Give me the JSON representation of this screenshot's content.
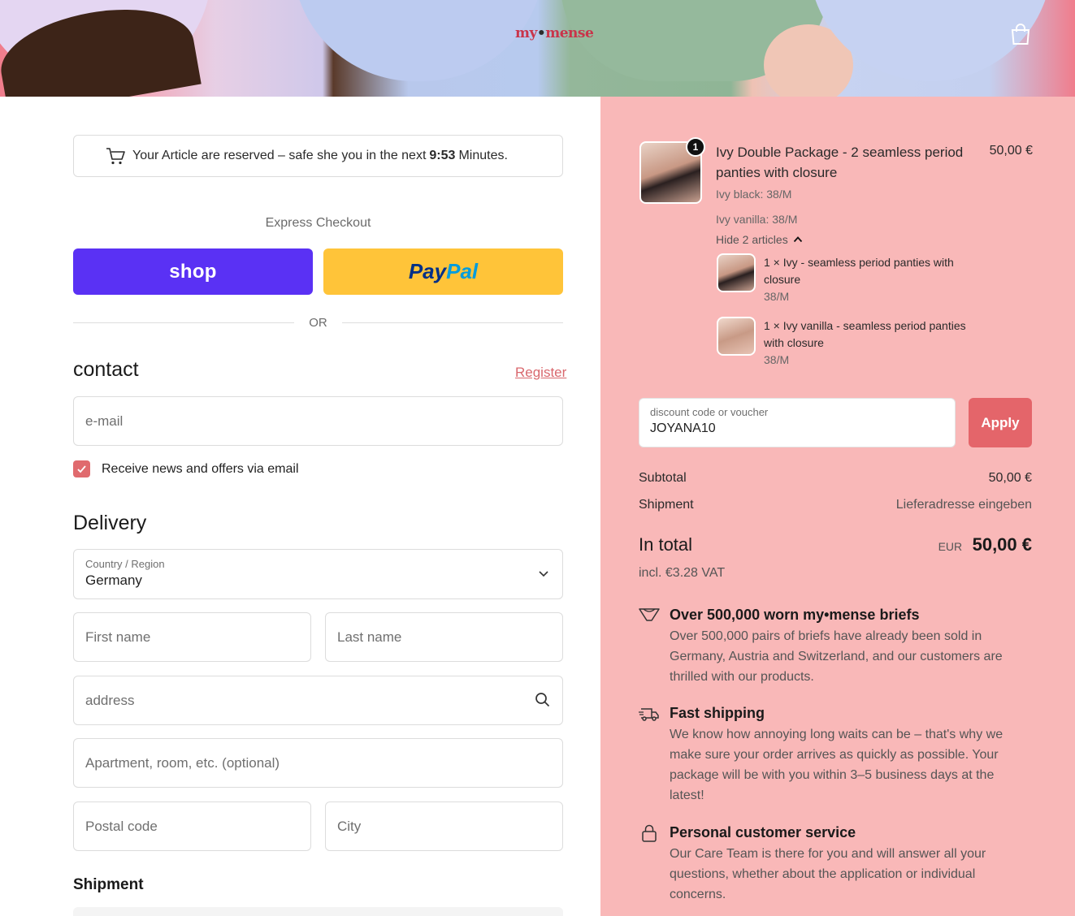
{
  "header": {
    "logo": {
      "brand": "my",
      "dot": "•",
      "brand2": "mense"
    },
    "cart_icon": "shopping-bag-icon"
  },
  "reservation": {
    "text_before": "Your Article are reserved – safe she you in the next",
    "time": "9:53",
    "text_after": "Minutes."
  },
  "express": {
    "label": "Express Checkout",
    "shop_label": "shop",
    "paypal_pay": "Pay",
    "paypal_pal": "Pal",
    "or_label": "OR"
  },
  "contact": {
    "title": "contact",
    "register_label": "Register",
    "email_placeholder": "e-mail",
    "newsletter_label": "Receive news and offers via email",
    "newsletter_checked": true
  },
  "delivery": {
    "title": "Delivery",
    "country_label": "Country / Region",
    "country_value": "Germany",
    "first_name_placeholder": "First name",
    "last_name_placeholder": "Last name",
    "address_placeholder": "address",
    "apartment_placeholder": "Apartment, room, etc. (optional)",
    "postal_placeholder": "Postal code",
    "city_placeholder": "City"
  },
  "shipment": {
    "title": "Shipment"
  },
  "order": {
    "product": {
      "quantity": "1",
      "title": "Ivy Double Package - 2 seamless period panties with closure",
      "price": "50,00 €",
      "variants": [
        "Ivy black: 38/M",
        "Ivy vanilla: 38/M"
      ],
      "hide_label": "Hide 2 articles"
    },
    "sub_items": [
      {
        "title": "1 × Ivy - seamless period panties with closure",
        "size": "38/M"
      },
      {
        "title": "1 × Ivy vanilla - seamless period panties with closure",
        "size": "38/M"
      }
    ],
    "discount": {
      "label": "discount code or voucher",
      "value": "JOYANA10",
      "apply_label": "Apply"
    },
    "summary": {
      "subtotal_label": "Subtotal",
      "subtotal_value": "50,00 €",
      "shipment_label": "Shipment",
      "shipment_value": "Lieferadresse eingeben",
      "total_label": "In total",
      "total_currency": "EUR",
      "total_value": "50,00 €",
      "vat_note": "incl. €3.28 VAT"
    },
    "features": [
      {
        "icon": "briefs-icon",
        "title": "Over 500,000 worn my•mense briefs",
        "text": "Over 500,000 pairs of briefs have already been sold in Germany, Austria and Switzerland, and our customers are thrilled with our products."
      },
      {
        "icon": "delivery-truck-icon",
        "title": "Fast shipping",
        "text": "We know how annoying long waits can be – that's why we make sure your order arrives as quickly as possible. Your package will be with you within 3–5 business days at the latest!"
      },
      {
        "icon": "lock-icon",
        "title": "Personal customer service",
        "text": "Our Care Team is there for you and will answer all your questions, whether about the application or individual concerns."
      }
    ]
  },
  "colors": {
    "shop_pay": "#5a31f4",
    "paypal": "#ffc439",
    "accent": "#e4656a",
    "summary_bg": "#f9b8b8"
  }
}
